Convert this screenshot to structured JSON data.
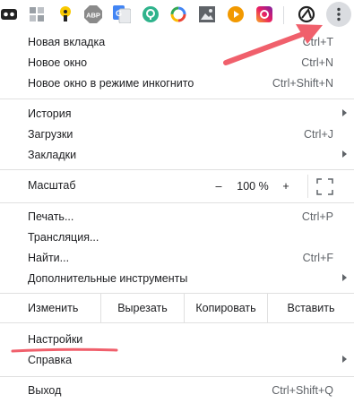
{
  "toolbar": {
    "extensions": [
      {
        "icon": "infinity-icon"
      },
      {
        "icon": "apps-grid-icon"
      },
      {
        "icon": "thumbtack-icon"
      },
      {
        "icon": "abp-icon",
        "label": "ABP"
      },
      {
        "icon": "translate-icon",
        "label": "G"
      },
      {
        "icon": "vpn-icon"
      },
      {
        "icon": "colorful-ring-icon"
      },
      {
        "icon": "picture-icon"
      },
      {
        "icon": "play-icon"
      },
      {
        "icon": "gradient-square-icon"
      },
      {
        "icon": "circle-a-icon"
      }
    ],
    "menu_button_icon": "kebab-menu-icon"
  },
  "menu": {
    "group1": [
      {
        "label": "Новая вкладка",
        "shortcut": "Ctrl+T"
      },
      {
        "label": "Новое окно",
        "shortcut": "Ctrl+N"
      },
      {
        "label": "Новое окно в режиме инкогнито",
        "shortcut": "Ctrl+Shift+N"
      }
    ],
    "group2": [
      {
        "label": "История",
        "shortcut": ""
      },
      {
        "label": "Загрузки",
        "shortcut": "Ctrl+J"
      },
      {
        "label": "Закладки",
        "shortcut": ""
      }
    ],
    "zoom": {
      "label": "Масштаб",
      "minus": "–",
      "value": "100 %",
      "plus": "+"
    },
    "group3": [
      {
        "label": "Печать...",
        "shortcut": "Ctrl+P"
      },
      {
        "label": "Трансляция...",
        "shortcut": ""
      },
      {
        "label": "Найти...",
        "shortcut": "Ctrl+F"
      },
      {
        "label": "Дополнительные инструменты",
        "shortcut": ""
      }
    ],
    "edit": {
      "label": "Изменить",
      "cut": "Вырезать",
      "copy": "Копировать",
      "paste": "Вставить"
    },
    "group4": [
      {
        "label": "Настройки",
        "shortcut": ""
      },
      {
        "label": "Справка",
        "shortcut": ""
      }
    ],
    "exit": {
      "label": "Выход",
      "shortcut": "Ctrl+Shift+Q"
    }
  },
  "colors": {
    "annotation": "#f0606c",
    "menu_button_bg": "#dadce0"
  }
}
